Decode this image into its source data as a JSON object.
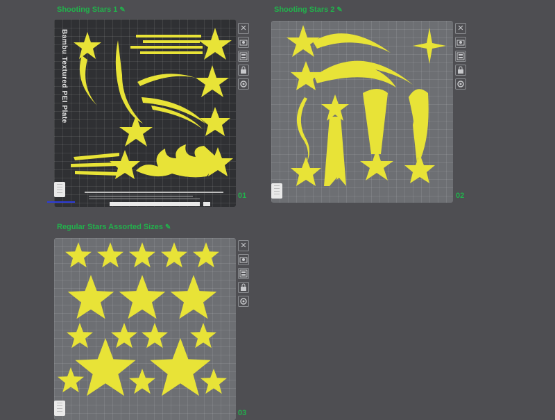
{
  "plates": [
    {
      "title": "Shooting Stars 1",
      "number": "01",
      "surface": "Bambu Textured PEI Plate"
    },
    {
      "title": "Shooting Stars 2",
      "number": "02"
    },
    {
      "title": "Regular Stars Assorted Sizes",
      "number": "03"
    }
  ],
  "toolbar_icons": [
    "close-icon",
    "auto-orient-icon",
    "arrange-icon",
    "lock-icon",
    "settings-icon"
  ],
  "colors": {
    "background": "#4e4e52",
    "accent": "#22b14c",
    "model": "#e8e337",
    "textured_plate": "#2f3033",
    "smooth_plate": "#6d6f73"
  }
}
